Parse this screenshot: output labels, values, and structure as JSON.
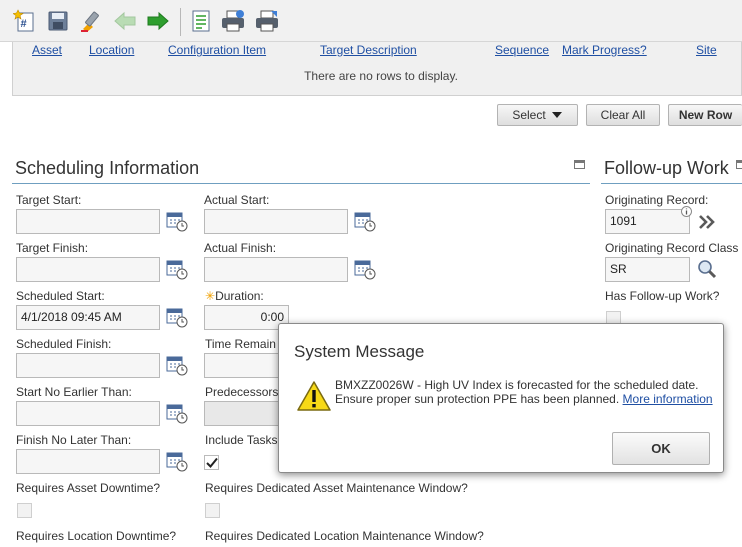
{
  "table": {
    "columns": [
      "Asset",
      "Location",
      "Configuration Item",
      "Target Description",
      "Sequence",
      "Mark Progress?",
      "Site"
    ],
    "empty_message": "There are no rows to display.",
    "buttons": {
      "select": "Select",
      "clear_all": "Clear All",
      "new_row": "New Row"
    }
  },
  "scheduling": {
    "title": "Scheduling Information",
    "target_start": {
      "label": "Target Start:",
      "value": ""
    },
    "target_finish": {
      "label": "Target Finish:",
      "value": ""
    },
    "scheduled_start": {
      "label": "Scheduled Start:",
      "value": "4/1/2018 09:45 AM"
    },
    "scheduled_finish": {
      "label": "Scheduled Finish:",
      "value": ""
    },
    "start_no_earlier": {
      "label": "Start No Earlier Than:",
      "value": ""
    },
    "finish_no_later": {
      "label": "Finish No Later Than:",
      "value": ""
    },
    "requires_asset_downtime": {
      "label": "Requires Asset Downtime?"
    },
    "requires_location_downtime": {
      "label": "Requires Location Downtime?"
    },
    "actual_start": {
      "label": "Actual Start:",
      "value": ""
    },
    "actual_finish": {
      "label": "Actual Finish:",
      "value": ""
    },
    "duration": {
      "required_mark": "✳",
      "label": "Duration:",
      "value": "0:00"
    },
    "time_remaining": {
      "label": "Time Remain"
    },
    "predecessors": {
      "label": "Predecessors"
    },
    "include_tasks": {
      "label": "Include Tasks",
      "checked": true
    },
    "requires_asset_window": {
      "label": "Requires Dedicated Asset Maintenance Window?"
    },
    "requires_location_window": {
      "label": "Requires Dedicated Location Maintenance Window?"
    }
  },
  "followup": {
    "title": "Follow-up Work",
    "originating_record": {
      "label": "Originating Record:",
      "value": "1091"
    },
    "originating_class": {
      "label": "Originating Record Class",
      "value": "SR"
    },
    "has_followup": {
      "label": "Has Follow-up Work?"
    }
  },
  "dialog": {
    "title": "System Message",
    "message": "BMXZZ0026W - High UV Index is forecasted for the scheduled date. Ensure proper sun protection PPE has been planned.",
    "link_text": "More information",
    "ok_label": "OK"
  },
  "colors": {
    "link": "#1f4fa3",
    "section_line": "#6f9fc0",
    "required": "#f0a000",
    "green_arrow": "#2e9e2e"
  }
}
